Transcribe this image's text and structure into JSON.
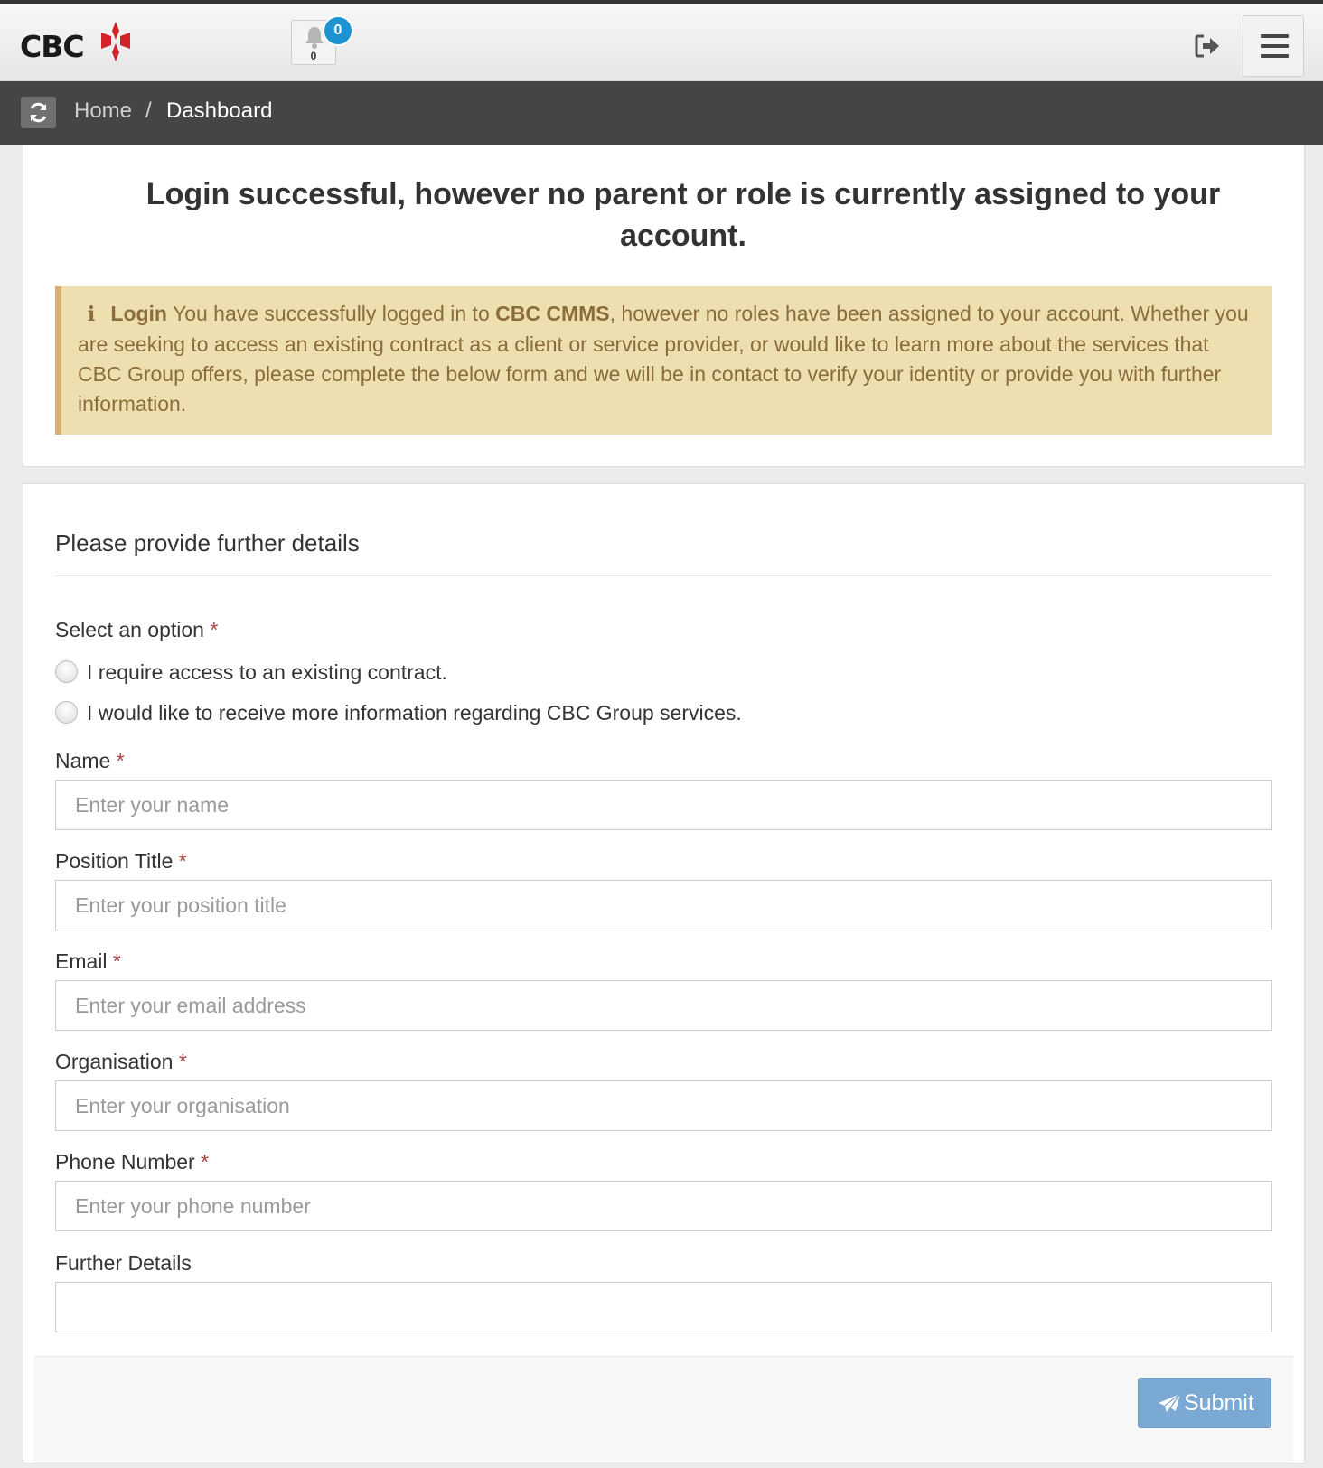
{
  "app": {
    "logo_text": "CBC",
    "notifications": {
      "badge_count": "0",
      "bell_count": "0"
    }
  },
  "breadcrumb": {
    "home": "Home",
    "separator": "/",
    "current": "Dashboard"
  },
  "notice": {
    "headline": "Login successful, however no parent or role is currently assigned to your account.",
    "alert_title": "Login",
    "alert_text_1": " You have successfully logged in to ",
    "alert_brand": "CBC CMMS",
    "alert_text_2": ", however no roles have been assigned to your account. Whether you are seeking to access an existing contract as a client or service provider, or would like to learn more about the services that CBC Group offers, please complete the below form and we will be in contact to verify your identity or provide you with further information."
  },
  "form": {
    "title": "Please provide further details",
    "required_mark": "*",
    "option_label": "Select an option",
    "options": [
      "I require access to an existing contract.",
      "I would like to receive more information regarding CBC Group services."
    ],
    "name_label": "Name",
    "name_placeholder": "Enter your name",
    "position_label": "Position Title",
    "position_placeholder": "Enter your position title",
    "email_label": "Email",
    "email_placeholder": "Enter your email address",
    "org_label": "Organisation",
    "org_placeholder": "Enter your organisation",
    "phone_label": "Phone Number",
    "phone_placeholder": "Enter your phone number",
    "details_label": "Further Details",
    "submit_label": "Submit"
  },
  "colors": {
    "brand_red": "#d2232a",
    "alert_bg": "#eedfb1",
    "alert_text": "#8a6d3b",
    "badge_blue": "#1d93d2",
    "submit_blue": "#7aa9d4",
    "required_red": "#a94442"
  },
  "icons": [
    "cbc-logo-icon",
    "bell-icon",
    "logout-icon",
    "hamburger-menu-icon",
    "refresh-icon",
    "info-icon",
    "paper-plane-icon"
  ]
}
